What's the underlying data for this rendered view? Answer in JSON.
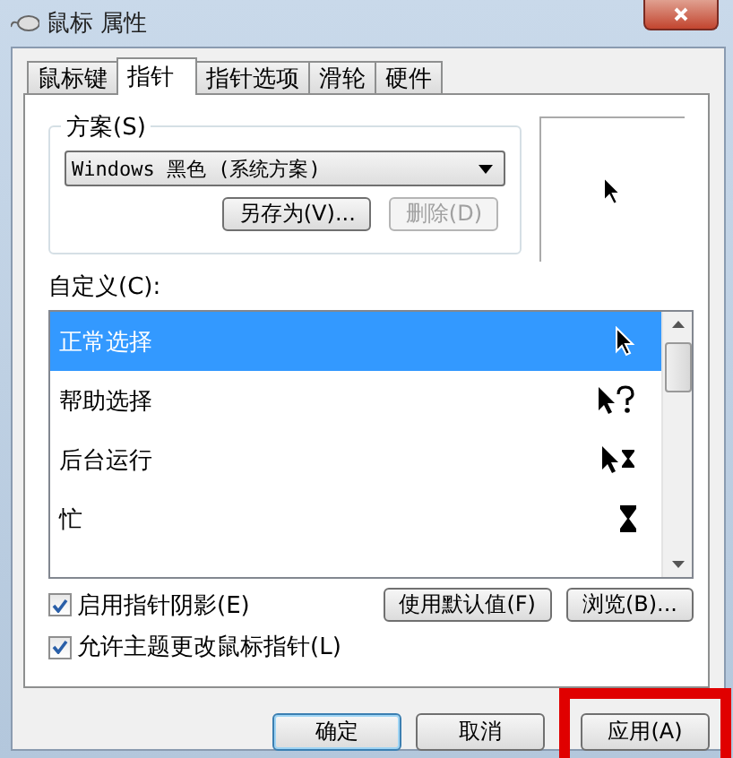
{
  "window": {
    "title": "鼠标 属性"
  },
  "tabs": [
    {
      "label": "鼠标键",
      "selected": false
    },
    {
      "label": "指针",
      "selected": true
    },
    {
      "label": "指针选项",
      "selected": false
    },
    {
      "label": "滑轮",
      "selected": false
    },
    {
      "label": "硬件",
      "selected": false
    }
  ],
  "scheme": {
    "label": "方案(S)",
    "value": "Windows 黑色 (系统方案)",
    "buttons": [
      {
        "label": "另存为(V)...",
        "disabled": false
      },
      {
        "label": "删除(D)",
        "disabled": true
      }
    ]
  },
  "customize": {
    "label": "自定义(C):",
    "items": [
      {
        "label": "正常选择",
        "kind": "arrow",
        "selected": true
      },
      {
        "label": "帮助选择",
        "kind": "help",
        "selected": false
      },
      {
        "label": "后台运行",
        "kind": "working",
        "selected": false
      },
      {
        "label": "忙",
        "kind": "busy",
        "selected": false
      }
    ]
  },
  "options": [
    {
      "label": "启用指针阴影(E)",
      "checked": true
    },
    {
      "label": "允许主题更改鼠标指针(L)",
      "checked": true
    }
  ],
  "list_buttons": [
    "使用默认值(F)",
    "浏览(B)..."
  ],
  "footer_buttons": [
    {
      "label": "确定",
      "default": true,
      "highlighted": false
    },
    {
      "label": "取消",
      "default": false,
      "highlighted": false
    },
    {
      "label": "应用(A)",
      "default": false,
      "highlighted": true
    }
  ]
}
